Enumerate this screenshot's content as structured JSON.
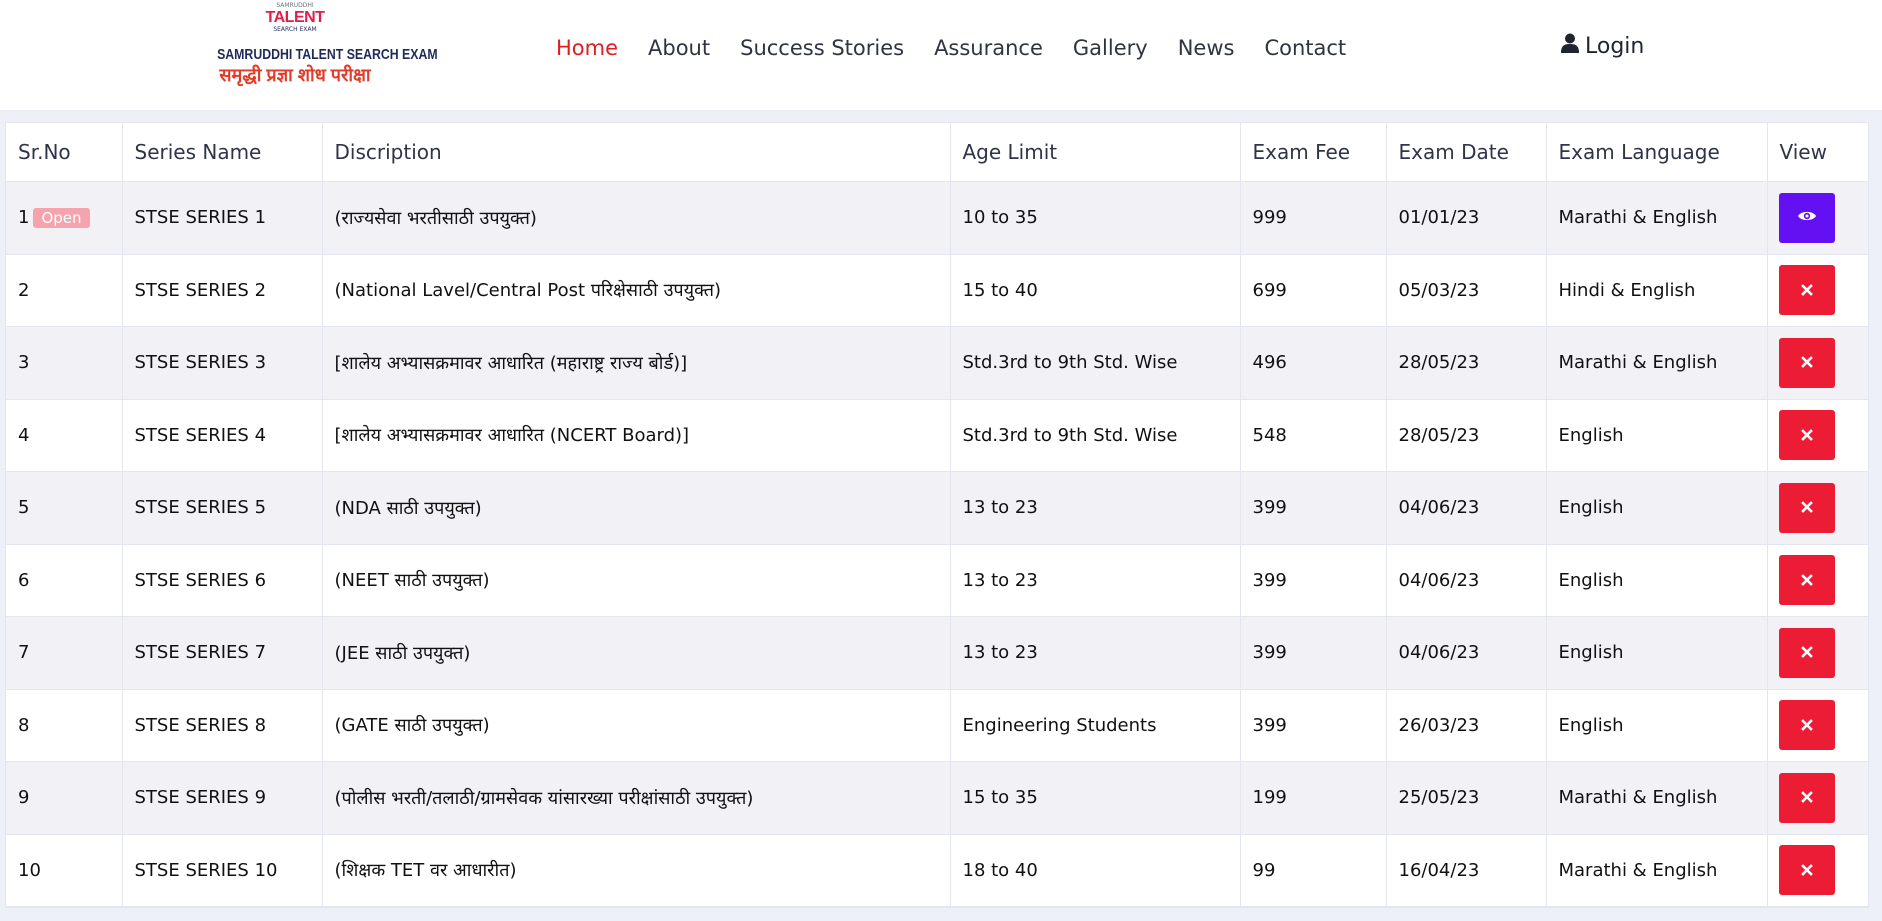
{
  "logo": {
    "small": "SAMRUDDHI",
    "talent": "TALENT",
    "search": "SEARCH EXAM",
    "title": "SAMRUDDHI TALENT SEARCH EXAM",
    "marathi": "समृद्धी प्रज्ञा शोध परीक्षा"
  },
  "nav": {
    "items": [
      "Home",
      "About",
      "Success Stories",
      "Assurance",
      "Gallery",
      "News",
      "Contact"
    ],
    "active": "Home",
    "login_label": "Login"
  },
  "table": {
    "headers": [
      "Sr.No",
      "Series Name",
      "Discription",
      "Age Limit",
      "Exam Fee",
      "Exam Date",
      "Exam Language",
      "View"
    ],
    "rows": [
      {
        "sr": "1",
        "badge": "Open",
        "name": "STSE SERIES 1",
        "desc": "(राज्यसेवा भरतीसाठी उपयुक्त)",
        "age": "10 to 35",
        "fee": "999",
        "date": "01/01/23",
        "lang": "Marathi & English",
        "view": "open"
      },
      {
        "sr": "2",
        "name": "STSE SERIES 2",
        "desc": "(National Lavel/Central Post परिक्षेसाठी उपयुक्त)",
        "age": "15 to 40",
        "fee": "699",
        "date": "05/03/23",
        "lang": "Hindi & English",
        "view": "closed"
      },
      {
        "sr": "3",
        "name": "STSE SERIES 3",
        "desc": "[शालेय अभ्यासक्रमावर आधारित (महाराष्ट्र राज्य बोर्ड)]",
        "age": "Std.3rd to 9th Std. Wise",
        "fee": "496",
        "date": "28/05/23",
        "lang": "Marathi & English",
        "view": "closed"
      },
      {
        "sr": "4",
        "name": "STSE SERIES 4",
        "desc": "[शालेय अभ्यासक्रमावर आधारित (NCERT Board)]",
        "age": "Std.3rd to 9th Std. Wise",
        "fee": "548",
        "date": "28/05/23",
        "lang": "English",
        "view": "closed"
      },
      {
        "sr": "5",
        "name": "STSE SERIES 5",
        "desc": "(NDA साठी उपयुक्त)",
        "age": "13 to 23",
        "fee": "399",
        "date": "04/06/23",
        "lang": "English",
        "view": "closed"
      },
      {
        "sr": "6",
        "name": "STSE SERIES 6",
        "desc": "(NEET साठी उपयुक्त)",
        "age": "13 to 23",
        "fee": "399",
        "date": "04/06/23",
        "lang": "English",
        "view": "closed"
      },
      {
        "sr": "7",
        "name": "STSE SERIES 7",
        "desc": "(JEE साठी उपयुक्त)",
        "age": "13 to 23",
        "fee": "399",
        "date": "04/06/23",
        "lang": "English",
        "view": "closed"
      },
      {
        "sr": "8",
        "name": "STSE SERIES 8",
        "desc": "(GATE साठी उपयुक्त)",
        "age": "Engineering Students",
        "fee": "399",
        "date": "26/03/23",
        "lang": "English",
        "view": "closed"
      },
      {
        "sr": "9",
        "name": "STSE SERIES 9",
        "desc": "(पोलीस भरती/तलाठी/ग्रामसेवक यांसारख्या परीक्षांसाठी उपयुक्त)",
        "age": "15 to 35",
        "fee": "199",
        "date": "25/05/23",
        "lang": "Marathi & English",
        "view": "closed"
      },
      {
        "sr": "10",
        "name": "STSE SERIES 10",
        "desc": "(शिक्षक TET वर आधारीत)",
        "age": "18 to 40",
        "fee": "99",
        "date": "16/04/23",
        "lang": "Marathi & English",
        "view": "closed"
      }
    ]
  },
  "colors": {
    "active_nav": "#e11d24",
    "view_button": "#6311f2",
    "closed_button": "#ed1c35",
    "badge": "#f5a3ad"
  },
  "icons": {
    "login": "user-icon",
    "view": "eye-icon",
    "closed": "close-icon"
  }
}
